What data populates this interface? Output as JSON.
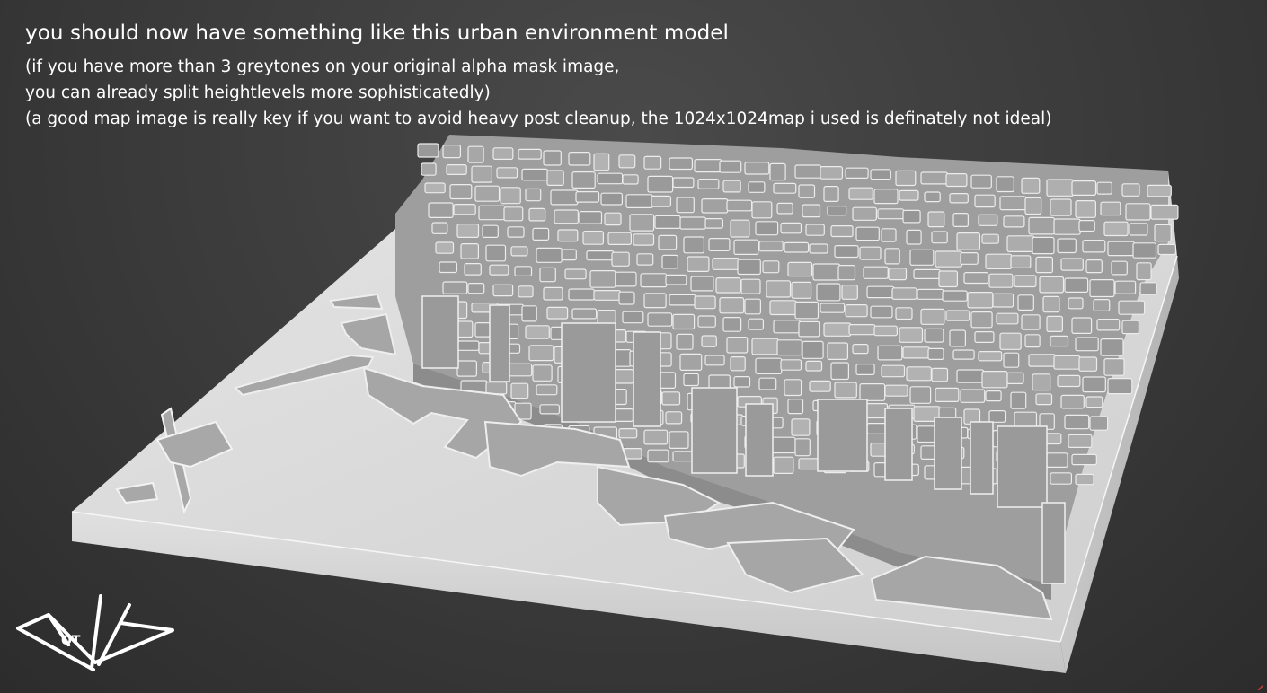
{
  "caption": {
    "title": "you should now have something like this urban environment model",
    "lines": [
      "(if you have more than 3 greytones on your original alpha mask image,",
      "you can already split heightlevels more sophisticatedly)",
      "(a good map image is really key if you want to avoid heavy post cleanup, the 1024x1024map i used is definately not ideal)"
    ]
  },
  "logo": {
    "icon": "qt-signature-logo",
    "text": "QT"
  },
  "colors": {
    "background": "#3a3a3a",
    "text": "#ffffff",
    "base_plate": "#dcdcdc",
    "building_roof": "#a4a4a4",
    "building_side": "#8a8a8a",
    "edge_highlight": "#f2f2f2"
  }
}
